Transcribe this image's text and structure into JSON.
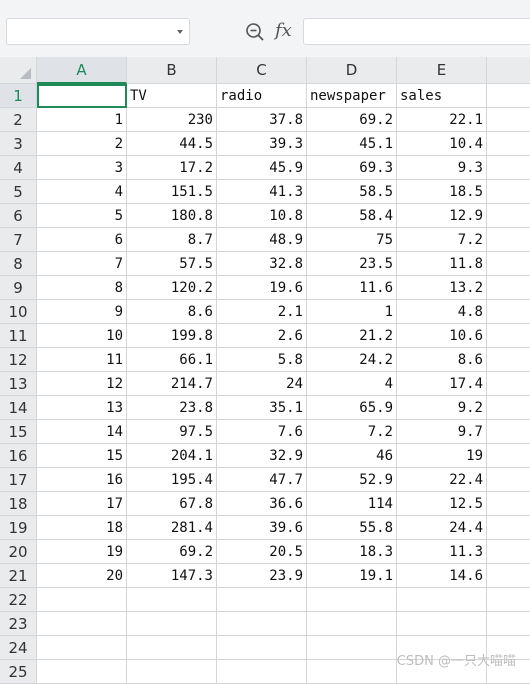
{
  "toolbar": {
    "name_box_value": "",
    "formula_value": "",
    "fx_label": "fx"
  },
  "columns": [
    "A",
    "B",
    "C",
    "D",
    "E"
  ],
  "selected_column": "A",
  "selected_row": "1",
  "row_numbers": [
    "1",
    "2",
    "3",
    "4",
    "5",
    "6",
    "7",
    "8",
    "9",
    "10",
    "11",
    "12",
    "13",
    "14",
    "15",
    "16",
    "17",
    "18",
    "19",
    "20",
    "21",
    "22",
    "23",
    "24",
    "25"
  ],
  "rows": [
    [
      "",
      "TV",
      "radio",
      "newspaper",
      "sales"
    ],
    [
      "1",
      "230",
      "37.8",
      "69.2",
      "22.1"
    ],
    [
      "2",
      "44.5",
      "39.3",
      "45.1",
      "10.4"
    ],
    [
      "3",
      "17.2",
      "45.9",
      "69.3",
      "9.3"
    ],
    [
      "4",
      "151.5",
      "41.3",
      "58.5",
      "18.5"
    ],
    [
      "5",
      "180.8",
      "10.8",
      "58.4",
      "12.9"
    ],
    [
      "6",
      "8.7",
      "48.9",
      "75",
      "7.2"
    ],
    [
      "7",
      "57.5",
      "32.8",
      "23.5",
      "11.8"
    ],
    [
      "8",
      "120.2",
      "19.6",
      "11.6",
      "13.2"
    ],
    [
      "9",
      "8.6",
      "2.1",
      "1",
      "4.8"
    ],
    [
      "10",
      "199.8",
      "2.6",
      "21.2",
      "10.6"
    ],
    [
      "11",
      "66.1",
      "5.8",
      "24.2",
      "8.6"
    ],
    [
      "12",
      "214.7",
      "24",
      "4",
      "17.4"
    ],
    [
      "13",
      "23.8",
      "35.1",
      "65.9",
      "9.2"
    ],
    [
      "14",
      "97.5",
      "7.6",
      "7.2",
      "9.7"
    ],
    [
      "15",
      "204.1",
      "32.9",
      "46",
      "19"
    ],
    [
      "16",
      "195.4",
      "47.7",
      "52.9",
      "22.4"
    ],
    [
      "17",
      "67.8",
      "36.6",
      "114",
      "12.5"
    ],
    [
      "18",
      "281.4",
      "39.6",
      "55.8",
      "24.4"
    ],
    [
      "19",
      "69.2",
      "20.5",
      "18.3",
      "11.3"
    ],
    [
      "20",
      "147.3",
      "23.9",
      "19.1",
      "14.6"
    ],
    [
      "",
      "",
      "",
      "",
      ""
    ],
    [
      "",
      "",
      "",
      "",
      ""
    ],
    [
      "",
      "",
      "",
      "",
      ""
    ],
    [
      "",
      "",
      "",
      "",
      ""
    ]
  ],
  "watermark": "CSDN @一只大喵喵",
  "colors": {
    "accent": "#1e8a5a",
    "header_bg": "#eaebed",
    "grid_line": "#d4d6da"
  }
}
